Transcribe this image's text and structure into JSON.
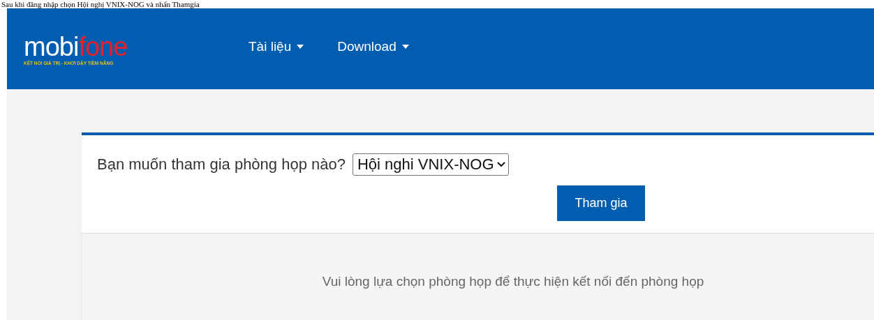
{
  "caption": "Sau khi đăng nhập chọn Hội nghị VNIX-NOG và nhấn Thamgia",
  "header": {
    "logo": {
      "wordmark": [
        "mobi",
        "fone"
      ],
      "tagline": "KẾT NỐI GIÁ TRỊ  -  KHƠI DẬY TIỀM NĂNG"
    },
    "menu": [
      {
        "label": "Tài liệu"
      },
      {
        "label": "Download"
      }
    ]
  },
  "form": {
    "question": "Bạn muốn tham gia phòng họp nào?",
    "room_select": {
      "value": "Hội nghi VNIX-NOG"
    },
    "button": "Tham gia"
  },
  "message": "Vui lòng lựa chọn phòng họp để thực hiện kết nối đến phòng họp"
}
